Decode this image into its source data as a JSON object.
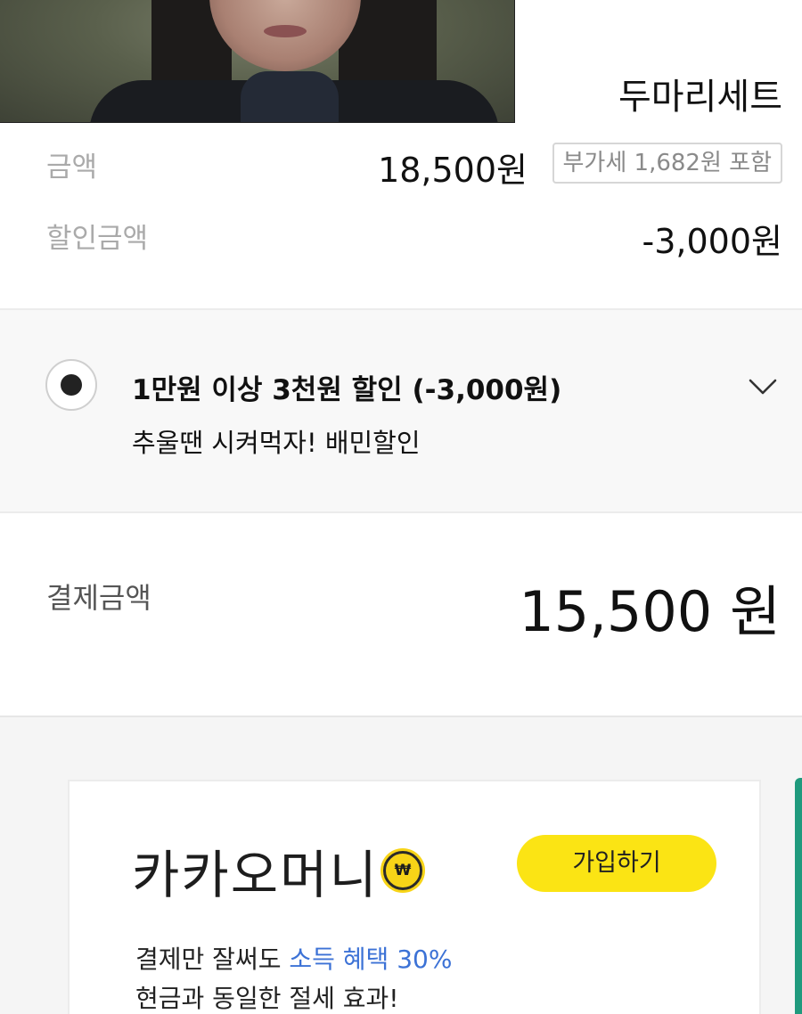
{
  "product": {
    "name": "두마리세트"
  },
  "price": {
    "amount_label": "금액",
    "amount_value": "18,500원",
    "vat_badge": "부가세 1,682원 포함",
    "discount_label": "할인금액",
    "discount_value": "-3,000원"
  },
  "coupon": {
    "selected": true,
    "title": "1만원 이상 3천원 할인 (-3,000원)",
    "description": "추울땐 시켜먹자! 배민할인"
  },
  "total": {
    "label": "결제금액",
    "value": "15,500 원"
  },
  "kakao_money": {
    "brand": "카카오머니",
    "coin_symbol": "₩",
    "join_label": "가입하기",
    "promo_prefix": "결제만 잘써도 ",
    "promo_highlight": "소득 혜택 30%",
    "promo_line2": "현금과 동일한 절세 효과!"
  },
  "colors": {
    "accent_yellow": "#fbe414",
    "highlight_blue": "#3c72d6",
    "side_accent_green": "#1f9a7d",
    "label_gray": "#aaaaaa"
  },
  "icons": {
    "expand": "chevron-down-icon",
    "radio": "radio-selected-icon",
    "coin": "won-coin-icon"
  }
}
